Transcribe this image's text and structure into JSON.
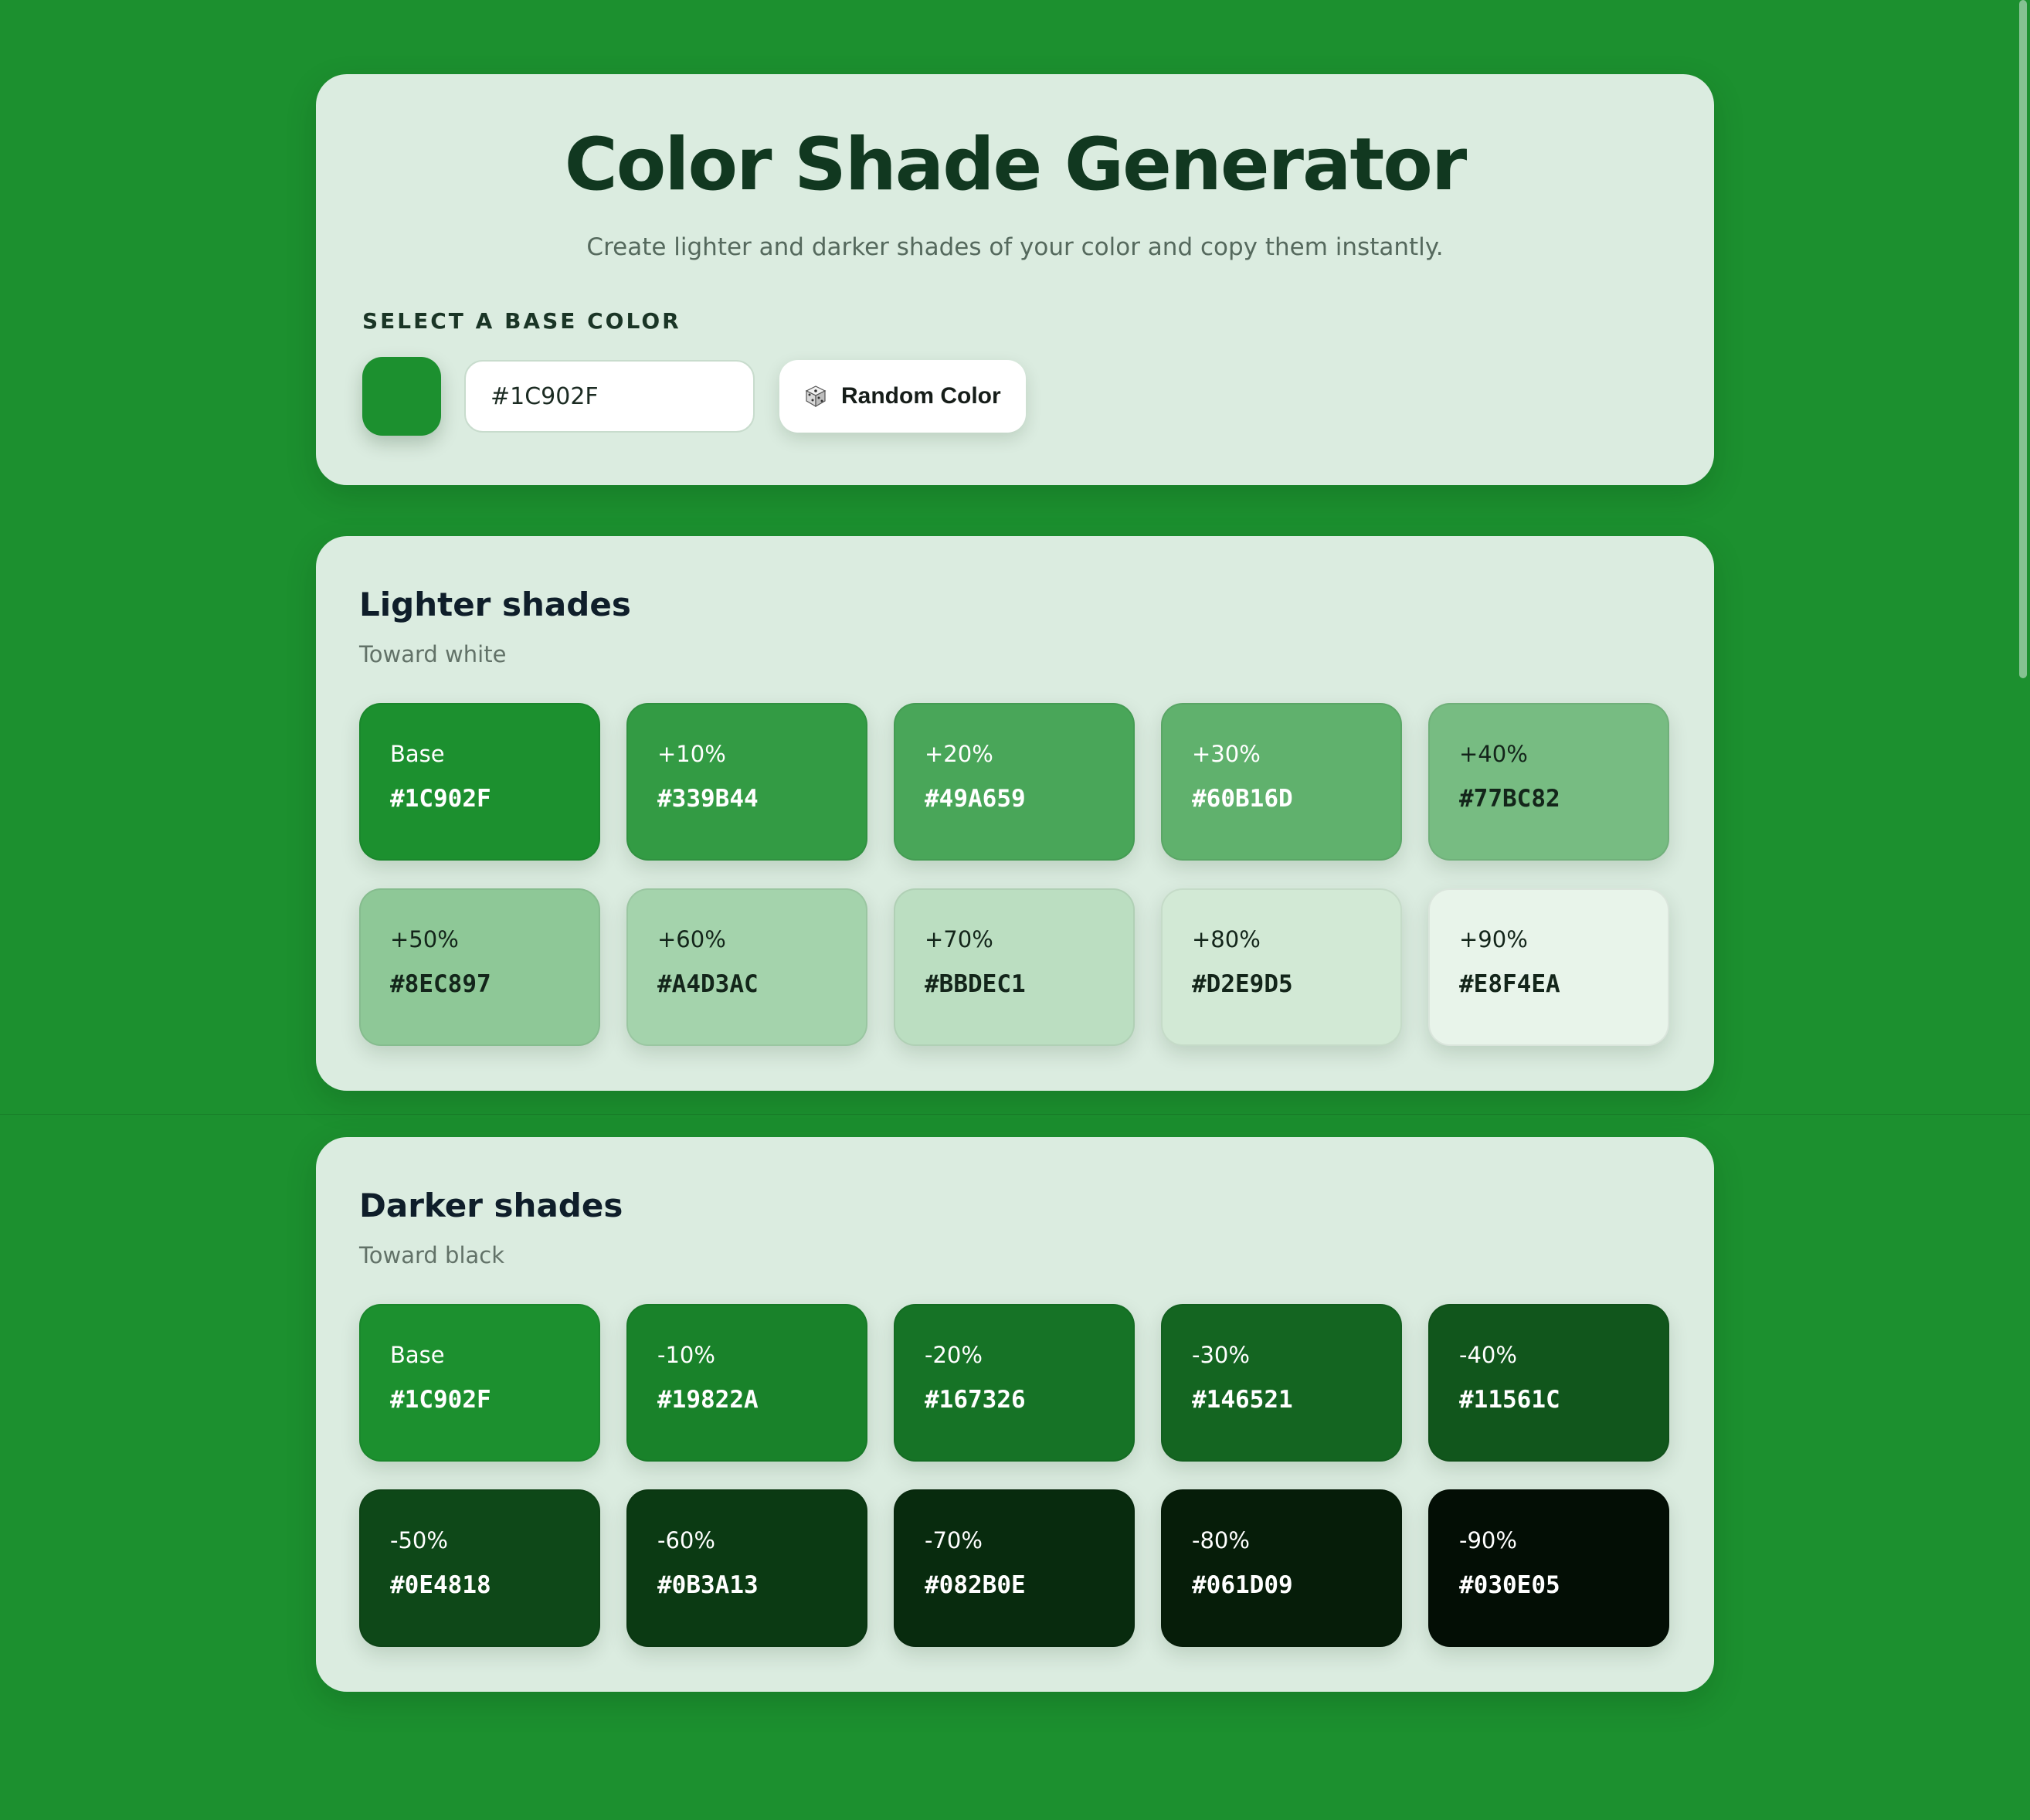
{
  "page": {
    "title": "Color Shade Generator",
    "subtitle": "Create lighter and darker shades of your color and copy them instantly."
  },
  "picker": {
    "label": "SELECT A BASE COLOR",
    "base_color": "#1C902F",
    "hex_value": "#1C902F",
    "random_button": {
      "icon": "dice-icon",
      "label": "Random Color"
    }
  },
  "lighter": {
    "title": "Lighter shades",
    "subtitle": "Toward white",
    "tiles": [
      {
        "label": "Base",
        "hex": "#1C902F",
        "text_color": "#ffffff"
      },
      {
        "label": "+10%",
        "hex": "#339B44",
        "text_color": "#ffffff"
      },
      {
        "label": "+20%",
        "hex": "#49A659",
        "text_color": "#ffffff"
      },
      {
        "label": "+30%",
        "hex": "#60B16D",
        "text_color": "#ffffff"
      },
      {
        "label": "+40%",
        "hex": "#77BC82",
        "text_color": "#13251a"
      },
      {
        "label": "+50%",
        "hex": "#8EC897",
        "text_color": "#13251a"
      },
      {
        "label": "+60%",
        "hex": "#A4D3AC",
        "text_color": "#13251a"
      },
      {
        "label": "+70%",
        "hex": "#BBDEC1",
        "text_color": "#13251a"
      },
      {
        "label": "+80%",
        "hex": "#D2E9D5",
        "text_color": "#13251a"
      },
      {
        "label": "+90%",
        "hex": "#E8F4EA",
        "text_color": "#13251a"
      }
    ]
  },
  "darker": {
    "title": "Darker shades",
    "subtitle": "Toward black",
    "tiles": [
      {
        "label": "Base",
        "hex": "#1C902F",
        "text_color": "#ffffff"
      },
      {
        "label": "-10%",
        "hex": "#19822A",
        "text_color": "#ffffff"
      },
      {
        "label": "-20%",
        "hex": "#167326",
        "text_color": "#ffffff"
      },
      {
        "label": "-30%",
        "hex": "#146521",
        "text_color": "#ffffff"
      },
      {
        "label": "-40%",
        "hex": "#11561C",
        "text_color": "#ffffff"
      },
      {
        "label": "-50%",
        "hex": "#0E4818",
        "text_color": "#ffffff"
      },
      {
        "label": "-60%",
        "hex": "#0B3A13",
        "text_color": "#ffffff"
      },
      {
        "label": "-70%",
        "hex": "#082B0E",
        "text_color": "#ffffff"
      },
      {
        "label": "-80%",
        "hex": "#061D09",
        "text_color": "#ffffff"
      },
      {
        "label": "-90%",
        "hex": "#030E05",
        "text_color": "#ffffff"
      }
    ]
  }
}
